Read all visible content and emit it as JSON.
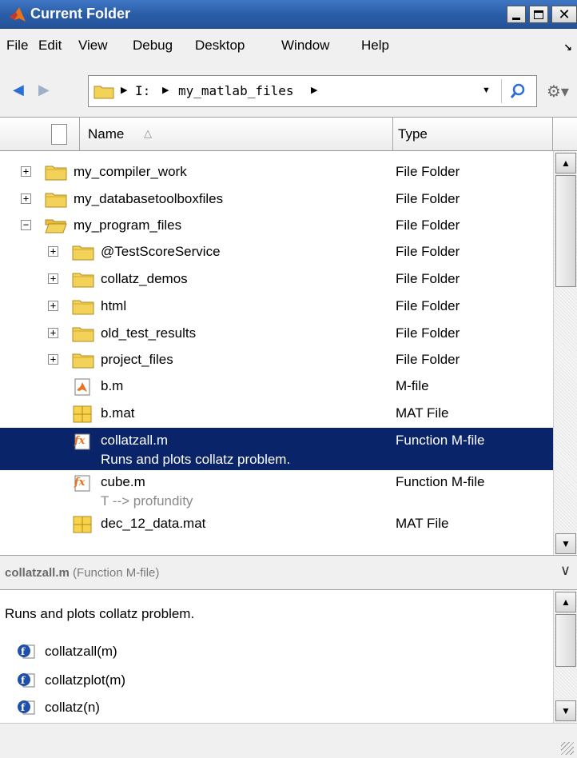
{
  "window": {
    "title": "Current Folder"
  },
  "menu": [
    "File",
    "Edit",
    "View",
    "Debug",
    "Desktop",
    "Window",
    "Help"
  ],
  "address": {
    "segments": [
      "I:",
      "my_matlab_files"
    ]
  },
  "columns": {
    "name": "Name",
    "type": "Type"
  },
  "tree": [
    {
      "label": "my_compiler_work",
      "type": "File Folder",
      "icon": "folder-icon",
      "expander": "+"
    },
    {
      "label": "my_databasetoolboxfiles",
      "type": "File Folder",
      "icon": "folder-icon",
      "expander": "+"
    },
    {
      "label": "my_program_files",
      "type": "File Folder",
      "icon": "folder-open-icon",
      "expander": "−"
    },
    {
      "label": "@TestScoreService",
      "type": "File Folder",
      "icon": "folder-icon",
      "expander": "+"
    },
    {
      "label": "collatz_demos",
      "type": "File Folder",
      "icon": "folder-icon",
      "expander": "+"
    },
    {
      "label": "html",
      "type": "File Folder",
      "icon": "folder-icon",
      "expander": "+"
    },
    {
      "label": "old_test_results",
      "type": "File Folder",
      "icon": "folder-icon",
      "expander": "+"
    },
    {
      "label": "project_files",
      "type": "File Folder",
      "icon": "folder-icon",
      "expander": "+"
    },
    {
      "label": "b.m",
      "type": "M-file",
      "icon": "m-file-icon"
    },
    {
      "label": "b.mat",
      "type": "MAT File",
      "icon": "mat-file-icon"
    },
    {
      "label": "collatzall.m",
      "type": "Function M-file",
      "icon": "function-file-icon",
      "description": "Runs and plots collatz problem."
    },
    {
      "label": "cube.m",
      "type": "Function M-file",
      "icon": "function-file-icon",
      "description": "T --> profundity"
    },
    {
      "label": "dec_12_data.mat",
      "type": "MAT File",
      "icon": "mat-file-icon"
    }
  ],
  "details": {
    "file": "collatzall.m",
    "kind": "(Function M-file)",
    "description": "Runs and plots collatz problem.",
    "functions": [
      "collatzall(m)",
      "collatzplot(m)",
      "collatz(n)"
    ]
  },
  "colors": {
    "titlebar": "#2b5ea8",
    "selection": "#0a246a",
    "folder": "#f3d25a"
  }
}
